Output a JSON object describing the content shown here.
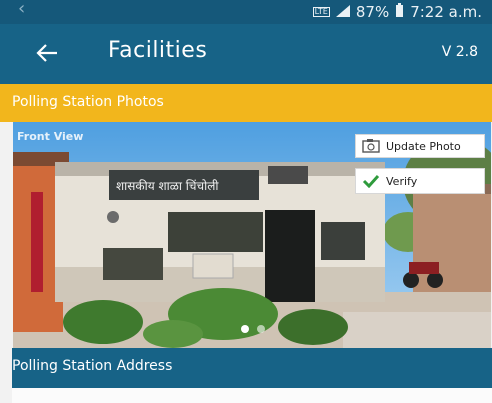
{
  "status_bar": {
    "network": "LTE",
    "battery": "87%",
    "time": "7:22 a.m."
  },
  "app_bar": {
    "title": "Facilities",
    "version": "V 2.8",
    "back_icon": "arrow-left-icon"
  },
  "section": {
    "title": "Polling Station Photos"
  },
  "photo": {
    "label": "Front View",
    "building_sign": "शासकीय शाळा चिंचोली"
  },
  "actions": {
    "update_photo": "Update Photo",
    "verify": "Verify"
  },
  "address_section": {
    "title": "Polling Station Address"
  },
  "colors": {
    "primary": "#176387",
    "accent": "#f2b61c",
    "verify_check": "#2e9b3c"
  }
}
